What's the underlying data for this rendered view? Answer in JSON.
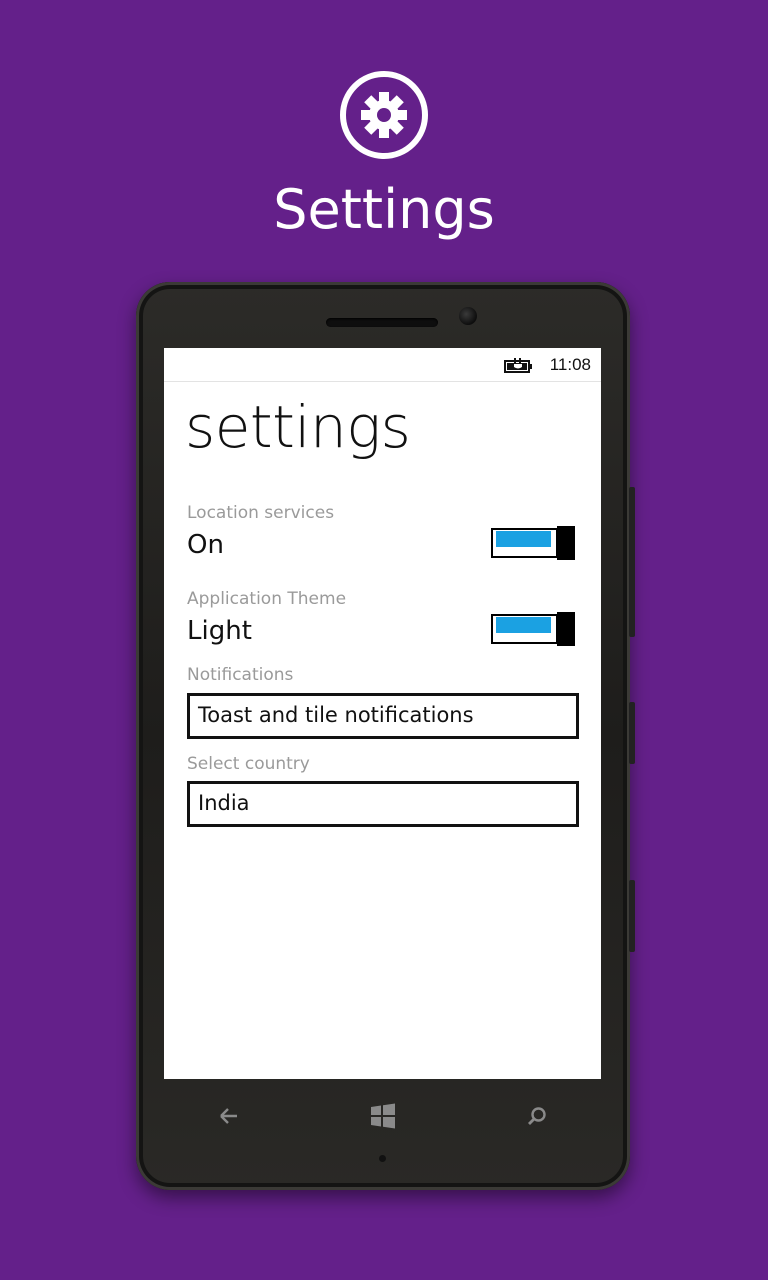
{
  "hero": {
    "icon": "gear-icon",
    "title": "Settings"
  },
  "statusbar": {
    "icon": "battery-charging-icon",
    "time": "11:08"
  },
  "page": {
    "title": "settings"
  },
  "settings": {
    "location": {
      "label": "Location services",
      "value": "On",
      "toggle_on": true
    },
    "theme": {
      "label": "Application Theme",
      "value": "Light",
      "toggle_on": true
    },
    "notifications": {
      "label": "Notifications",
      "value": "Toast and tile notifications"
    },
    "country": {
      "label": "Select country",
      "value": "India"
    }
  },
  "navbar": {
    "back": "back-arrow-icon",
    "home": "windows-logo-icon",
    "search": "search-icon"
  },
  "colors": {
    "background": "#64208a",
    "toggle_accent": "#1ba1e2"
  }
}
